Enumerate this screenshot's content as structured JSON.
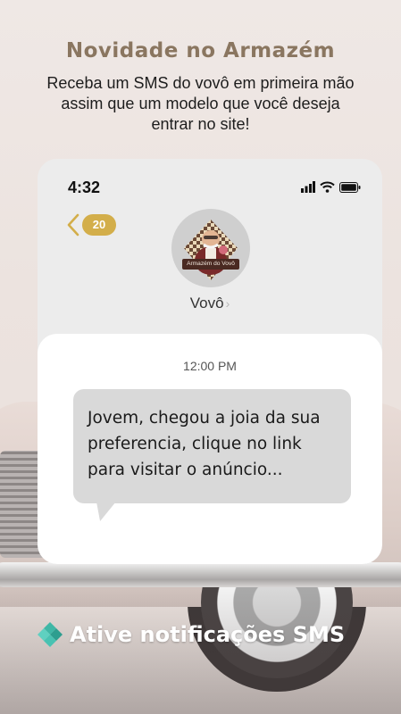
{
  "headline": "Novidade no Armazém",
  "subtext": "Receba um SMS do vovô em primeira mão assim que um modelo que você deseja entrar no site!",
  "phone": {
    "status_time": "4:32",
    "back_badge_count": "20",
    "avatar_brand": "Armazém do Vovô",
    "contact_name": "Vovô",
    "message_time": "12:00 PM",
    "message_text": "Jovem, chegou a joia da sua preferencia, clique no link para visitar o anúncio..."
  },
  "cta": {
    "label": "Ative notificações SMS",
    "icon": "diamond-cluster-icon"
  },
  "colors": {
    "title_gold": "#8a7660",
    "badge_gold": "#d3ae4a",
    "cta_icon_teal": "#3fb7a6",
    "bubble_gray": "#d9d9d9"
  }
}
